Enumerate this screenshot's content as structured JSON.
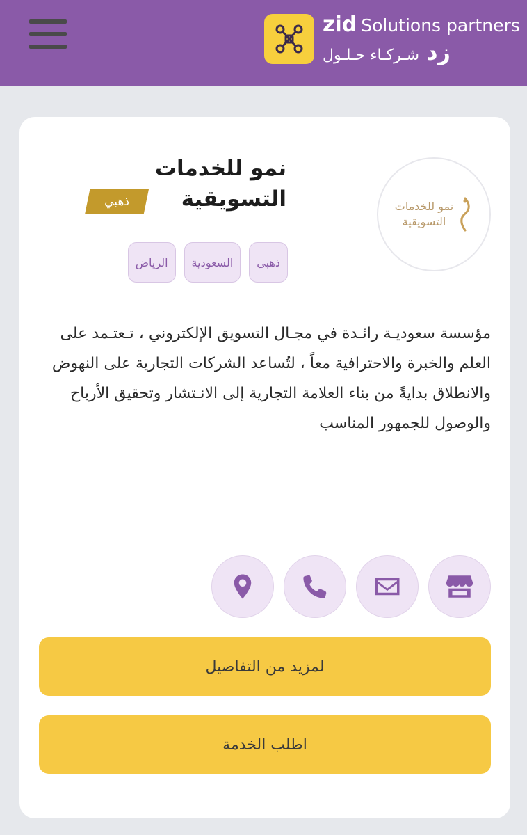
{
  "header": {
    "brand_zid": "zid",
    "brand_subtitle": "Solutions partners",
    "brand_zid_ar": "زد",
    "brand_subtitle_ar": "شـركـاء حـلـول",
    "logo_icon": "zid-partner-logo-icon",
    "menu_icon": "hamburger-menu-icon"
  },
  "company": {
    "logo_text_line1": "نمو للخدمات",
    "logo_text_line2": "التسويقية",
    "title": "نمو للخدمات التسويقية",
    "tier_badge": "ذهبي",
    "tags": [
      "ذهبي",
      "السعودية",
      "الرياض"
    ],
    "description": "مؤسسة سعوديـة رائـدة في مجـال التسويق الإلكتروني ، تـعتـمد على العلم والخبرة والاحترافية معاً ، لتُساعد الشركات التجارية على النهوض والانطلاق بدايةً من بناء العلامة التجارية إلى الانـتشار وتحقيق الأرباح والوصول للجمهور المناسب"
  },
  "actions": [
    {
      "icon": "store-icon"
    },
    {
      "icon": "mail-icon"
    },
    {
      "icon": "phone-icon"
    },
    {
      "icon": "location-pin-icon"
    }
  ],
  "buttons": {
    "details_label": "لمزيد من التفاصيل",
    "request_label": "اطلب الخدمة"
  },
  "colors": {
    "header_bg": "#8a5aa8",
    "accent_yellow": "#f6c944",
    "tag_bg": "#efe4f5",
    "gold_badge": "#c39a2c"
  }
}
